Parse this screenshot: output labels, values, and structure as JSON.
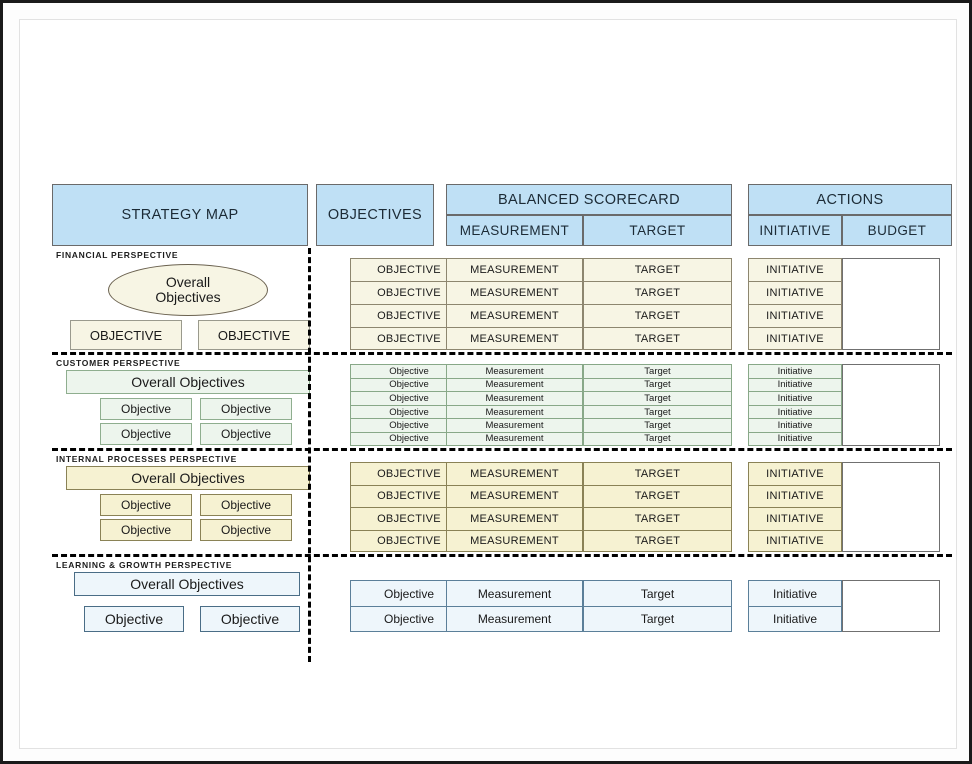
{
  "header": {
    "strategy_map": "STRATEGY MAP",
    "objectives": "OBJECTIVES",
    "balanced_scorecard": "BALANCED SCORECARD",
    "measurement": "MEASUREMENT",
    "target": "TARGET",
    "actions": "ACTIONS",
    "initiative": "INITIATIVE",
    "budget": "BUDGET"
  },
  "colors": {
    "header_fill": "#bfe0f5",
    "financial_fill": "#f7f5e4",
    "customer_fill": "#edf5ed",
    "internal_fill": "#f6f2d2",
    "learning_fill": "#eef6fb",
    "budget_fill": "#ffffff",
    "divider": "#000000"
  },
  "perspectives": [
    {
      "id": "financial",
      "label": "FINANCIAL PERSPECTIVE",
      "strategy_map": {
        "overall": "Overall\nObjectives",
        "overall_shape": "ellipse",
        "boxes": [
          "OBJECTIVE",
          "OBJECTIVE"
        ]
      },
      "objectives": [
        "OBJECTIVE",
        "OBJECTIVE",
        "OBJECTIVE",
        "OBJECTIVE"
      ],
      "measurements": [
        "MEASUREMENT",
        "MEASUREMENT",
        "MEASUREMENT",
        "MEASUREMENT"
      ],
      "targets": [
        "TARGET",
        "TARGET",
        "TARGET",
        "TARGET"
      ],
      "initiatives": [
        "INITIATIVE",
        "INITIATIVE",
        "INITIATIVE",
        "INITIATIVE"
      ],
      "budget": ""
    },
    {
      "id": "customer",
      "label": "CUSTOMER  PERSPECTIVE",
      "strategy_map": {
        "overall": "Overall Objectives",
        "overall_shape": "rect",
        "boxes": [
          "Objective",
          "Objective",
          "Objective",
          "Objective"
        ]
      },
      "objectives": [
        "Objective",
        "Objective",
        "Objective",
        "Objective",
        "Objective",
        "Objective"
      ],
      "measurements": [
        "Measurement",
        "Measurement",
        "Measurement",
        "Measurement",
        "Measurement",
        "Measurement"
      ],
      "targets": [
        "Target",
        "Target",
        "Target",
        "Target",
        "Target",
        "Target"
      ],
      "initiatives": [
        "Initiative",
        "Initiative",
        "Initiative",
        "Initiative",
        "Initiative",
        "Initiative"
      ],
      "budget": ""
    },
    {
      "id": "internal",
      "label": "INTERNAL  PROCESSES  PERSPECTIVE",
      "strategy_map": {
        "overall": "Overall Objectives",
        "overall_shape": "rect",
        "boxes": [
          "Objective",
          "Objective",
          "Objective",
          "Objective"
        ]
      },
      "objectives": [
        "OBJECTIVE",
        "OBJECTIVE",
        "OBJECTIVE",
        "OBJECTIVE"
      ],
      "measurements": [
        "MEASUREMENT",
        "MEASUREMENT",
        "MEASUREMENT",
        "MEASUREMENT"
      ],
      "targets": [
        "TARGET",
        "TARGET",
        "TARGET",
        "TARGET"
      ],
      "initiatives": [
        "INITIATIVE",
        "INITIATIVE",
        "INITIATIVE",
        "INITIATIVE"
      ],
      "budget": ""
    },
    {
      "id": "learning",
      "label": "LEARNING & GROWTH  PERSPECTIVE",
      "strategy_map": {
        "overall": "Overall Objectives",
        "overall_shape": "rect",
        "boxes": [
          "Objective",
          "Objective"
        ]
      },
      "objectives": [
        "Objective",
        "Objective"
      ],
      "measurements": [
        "Measurement",
        "Measurement"
      ],
      "targets": [
        "Target",
        "Target"
      ],
      "initiatives": [
        "Initiative",
        "Initiative"
      ],
      "budget": ""
    }
  ]
}
